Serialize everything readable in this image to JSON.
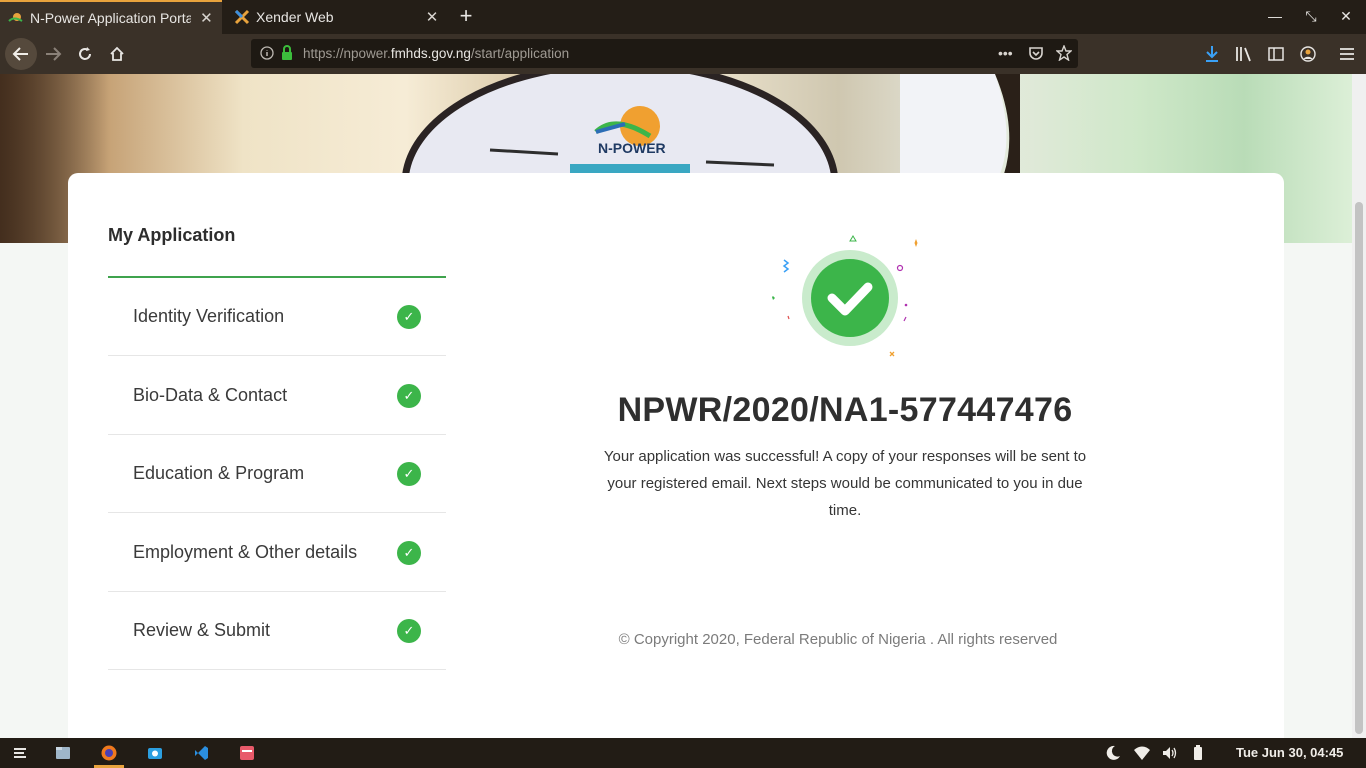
{
  "browser": {
    "tabs": [
      {
        "label": "N-Power Application Portal",
        "active": true,
        "icon": "npower-favicon-icon"
      },
      {
        "label": "Xender Web",
        "active": false,
        "icon": "xender-favicon-icon"
      }
    ],
    "url_prefix": "https://npower.",
    "url_domain": "fmhds.gov.ng",
    "url_path": "/start/application",
    "colors": {
      "chrome_dark": "#241e17",
      "chrome": "#3a3128",
      "accent": "#e8a33d"
    }
  },
  "sidebar": {
    "title": "My Application",
    "steps": [
      {
        "label": "Identity Verification",
        "status": "complete",
        "check": "✓"
      },
      {
        "label": "Bio-Data & Contact",
        "status": "complete",
        "check": "✓"
      },
      {
        "label": "Education & Program",
        "status": "complete",
        "check": "✓"
      },
      {
        "label": "Employment & Other details",
        "status": "complete",
        "check": "✓"
      },
      {
        "label": "Review & Submit",
        "status": "complete",
        "check": "✓"
      }
    ],
    "accent_color": "#3fa34d"
  },
  "hero": {
    "logo_text": "N-POWER"
  },
  "main": {
    "success_icon": "check-circle-icon",
    "application_number": "NPWR/2020/NA1-577447476",
    "message": "Your application was successful! A copy of your responses will be sent to your registered email. Next steps would be communicated to you in due time.",
    "copyright": "© Copyright 2020, Federal Republic of Nigeria . All rights reserved",
    "success_color": "#3cb54a"
  },
  "taskbar": {
    "clock": "Tue Jun 30, 04:45"
  }
}
